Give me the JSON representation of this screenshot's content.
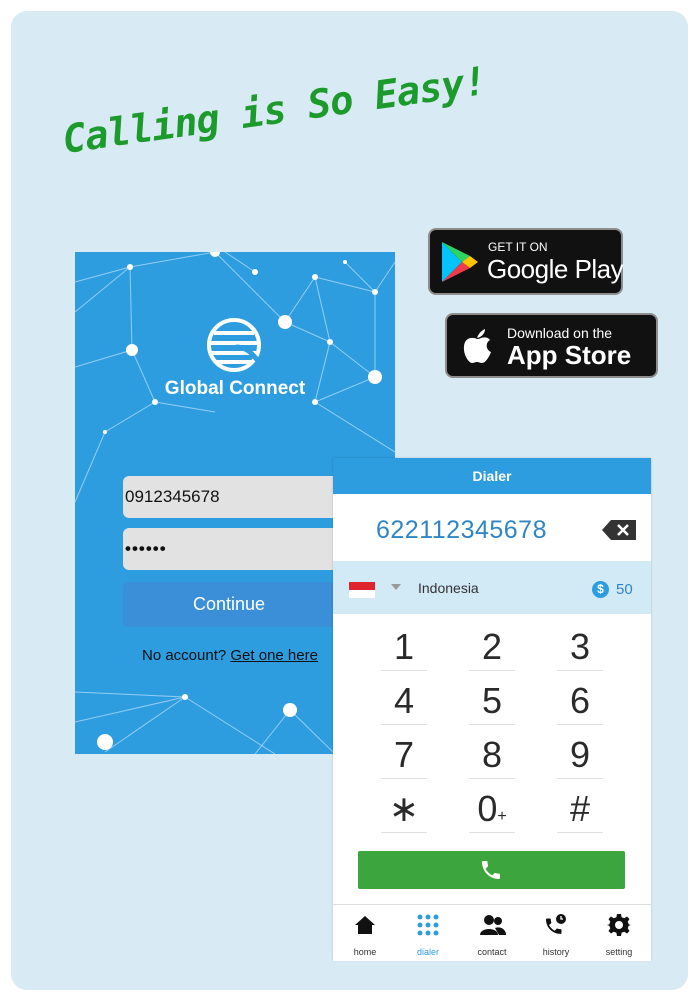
{
  "headline": "Calling is So Easy!",
  "stores": {
    "google_play": {
      "small": "GET IT ON",
      "big": "Google Play"
    },
    "app_store": {
      "small": "Download on the",
      "big": "App Store"
    }
  },
  "login": {
    "brand": "Global Connect",
    "phone_value": "0912345678",
    "password_value": "••••••",
    "continue_label": "Continue",
    "no_account_text": "No account? ",
    "get_one_link": "Get one here"
  },
  "dialer": {
    "title": "Dialer",
    "number": "622112345678",
    "country": "Indonesia",
    "credit_icon": "$",
    "credit": "50",
    "keys": [
      {
        "label": "1",
        "sub": ""
      },
      {
        "label": "2",
        "sub": ""
      },
      {
        "label": "3",
        "sub": ""
      },
      {
        "label": "4",
        "sub": ""
      },
      {
        "label": "5",
        "sub": ""
      },
      {
        "label": "6",
        "sub": ""
      },
      {
        "label": "7",
        "sub": ""
      },
      {
        "label": "8",
        "sub": ""
      },
      {
        "label": "9",
        "sub": ""
      },
      {
        "label": "∗",
        "sub": ""
      },
      {
        "label": "0",
        "sub": "+"
      },
      {
        "label": "#",
        "sub": ""
      }
    ],
    "tabs": [
      "home",
      "dialer",
      "contact",
      "history",
      "setting"
    ],
    "active_tab": "dialer"
  },
  "colors": {
    "brand_blue": "#2e9de0",
    "call_green": "#3da53d",
    "headline_green": "#1c9a2c"
  }
}
